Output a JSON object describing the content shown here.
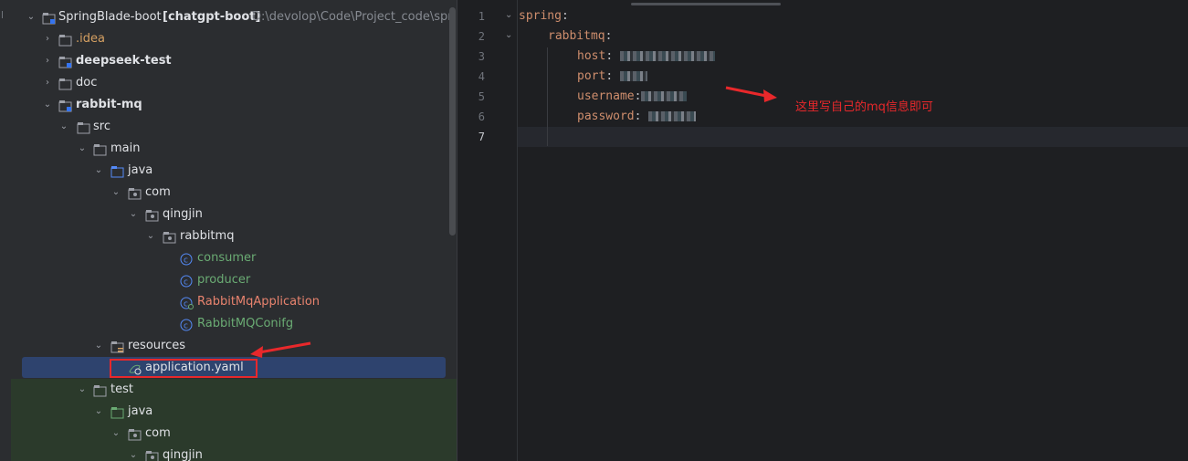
{
  "tree": {
    "root": {
      "name": "SpringBlade-boot",
      "module": "[chatgpt-boot]",
      "path": "D:\\devolop\\Code\\Project_code\\sprin"
    },
    "items": [
      {
        "label": "SpringBlade-boot",
        "color": "#dfe1e5"
      },
      {
        "label": ".idea",
        "color": "#d5a062"
      },
      {
        "label": "deepseek-test",
        "color": "#dfe1e5"
      },
      {
        "label": "doc",
        "color": "#dfe1e5"
      },
      {
        "label": "rabbit-mq",
        "color": "#dfe1e5"
      },
      {
        "label": "src",
        "color": "#dfe1e5"
      },
      {
        "label": "main",
        "color": "#dfe1e5"
      },
      {
        "label": "java",
        "color": "#dfe1e5"
      },
      {
        "label": "com",
        "color": "#dfe1e5"
      },
      {
        "label": "qingjin",
        "color": "#dfe1e5"
      },
      {
        "label": "rabbitmq",
        "color": "#dfe1e5"
      },
      {
        "label": "consumer",
        "color": "#6aab73"
      },
      {
        "label": "producer",
        "color": "#6aab73"
      },
      {
        "label": "RabbitMqApplication",
        "color": "#e8836e"
      },
      {
        "label": "RabbitMQConifg",
        "color": "#6aab73"
      },
      {
        "label": "resources",
        "color": "#dfe1e5"
      },
      {
        "label": "application.yaml",
        "color": "#dfe1e5"
      },
      {
        "label": "test",
        "color": "#dfe1e5"
      },
      {
        "label": "java",
        "color": "#dfe1e5"
      },
      {
        "label": "com",
        "color": "#dfe1e5"
      },
      {
        "label": "qingjin",
        "color": "#dfe1e5"
      }
    ]
  },
  "editor": {
    "line_numbers": [
      "1",
      "2",
      "3",
      "4",
      "5",
      "6",
      "7"
    ],
    "lines": [
      {
        "key": "spring",
        "colon": ":"
      },
      {
        "key": "rabbitmq",
        "colon": ":"
      },
      {
        "key": "host",
        "colon": ":"
      },
      {
        "key": "port",
        "colon": ":"
      },
      {
        "key": "username",
        "colon": ":"
      },
      {
        "key": "password",
        "colon": ":"
      }
    ],
    "annotation": "这里写自己的mq信息即可"
  },
  "colors": {
    "accent_red": "#e8282b",
    "key_orange": "#cf8e6d",
    "selection": "#2e436e"
  }
}
